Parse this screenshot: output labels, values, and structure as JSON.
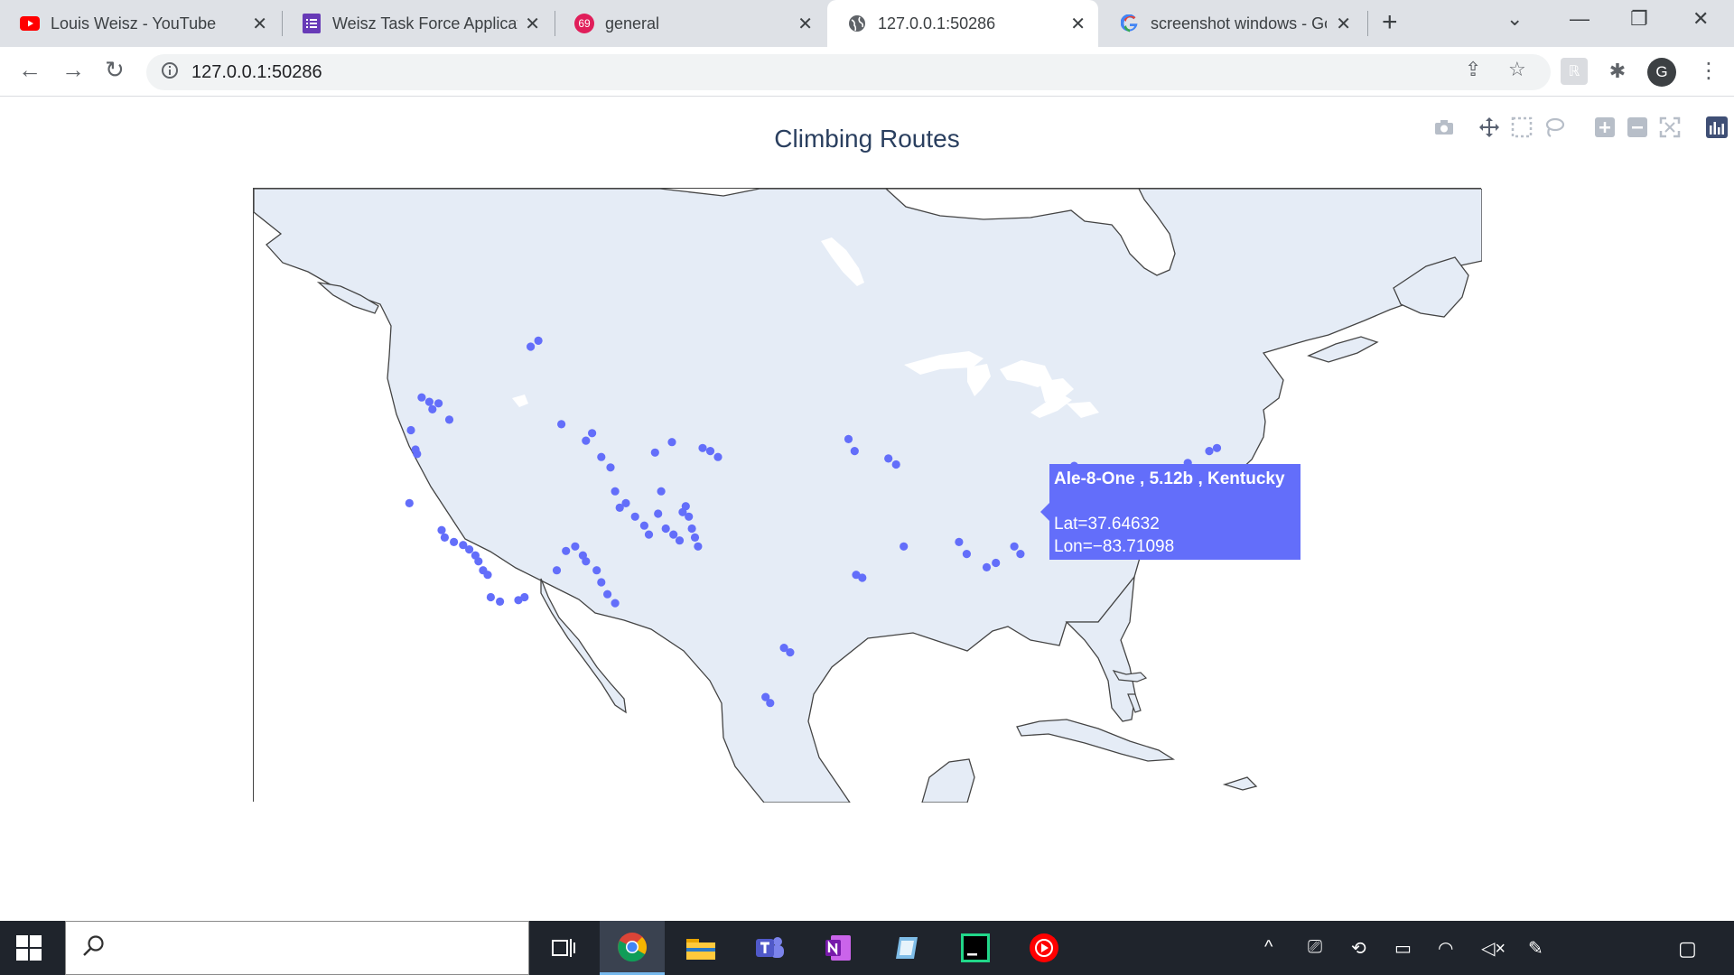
{
  "browser": {
    "tabs": [
      {
        "title": "Louis Weisz - YouTube",
        "icon": "youtube-icon"
      },
      {
        "title": "Weisz Task Force Application",
        "icon": "forms-icon"
      },
      {
        "title": "general",
        "icon": "slack-badge-icon",
        "badge": "69"
      },
      {
        "title": "127.0.0.1:50286",
        "icon": "globe-icon"
      },
      {
        "title": "screenshot windows - Google Search",
        "icon": "google-icon"
      }
    ],
    "active_tab": 3,
    "url": "127.0.0.1:50286",
    "profile_initial": "G"
  },
  "plot": {
    "title": "Climbing Routes",
    "marker_color": "#636efa",
    "land_color": "#e5ecf6",
    "modebar": [
      "camera-icon",
      "pan-icon",
      "box-select-icon",
      "lasso-icon",
      "zoom-in-icon",
      "zoom-out-icon",
      "reset-icon",
      "plotly-logo-icon"
    ],
    "tooltip": {
      "title": "Ale-8-One , 5.12b ,  Kentucky",
      "lat": "Lat=37.64632",
      "lon": "Lon=−83.71098"
    }
  },
  "chart_data": {
    "type": "scatter",
    "title": "Climbing Routes",
    "projection": "north-america",
    "lon_range": [
      -135,
      -55
    ],
    "lat_range": [
      18,
      60
    ],
    "x_label": "",
    "y_label": "",
    "points": [
      [
        -122.3,
        47.6
      ],
      [
        -121.8,
        47.3
      ],
      [
        -121.2,
        47.2
      ],
      [
        -121.6,
        46.8
      ],
      [
        -120.5,
        46.1
      ],
      [
        -123.0,
        45.4
      ],
      [
        -122.7,
        44.1
      ],
      [
        -122.6,
        43.8
      ],
      [
        -123.1,
        40.5
      ],
      [
        -121.0,
        38.7
      ],
      [
        -120.8,
        38.2
      ],
      [
        -120.2,
        37.9
      ],
      [
        -119.6,
        37.7
      ],
      [
        -119.2,
        37.4
      ],
      [
        -118.8,
        37.0
      ],
      [
        -118.6,
        36.6
      ],
      [
        -118.3,
        36.0
      ],
      [
        -118.0,
        35.7
      ],
      [
        -117.8,
        34.2
      ],
      [
        -117.2,
        33.9
      ],
      [
        -116.0,
        34.0
      ],
      [
        -115.6,
        34.2
      ],
      [
        -113.5,
        36.0
      ],
      [
        -112.9,
        37.3
      ],
      [
        -112.3,
        37.6
      ],
      [
        -111.8,
        37.0
      ],
      [
        -111.6,
        36.6
      ],
      [
        -110.9,
        36.0
      ],
      [
        -110.6,
        35.2
      ],
      [
        -110.2,
        34.4
      ],
      [
        -109.7,
        33.8
      ],
      [
        -115.2,
        51.0
      ],
      [
        -114.7,
        51.4
      ],
      [
        -113.2,
        45.8
      ],
      [
        -111.6,
        44.7
      ],
      [
        -111.2,
        45.2
      ],
      [
        -110.6,
        43.6
      ],
      [
        -110.0,
        42.9
      ],
      [
        -109.7,
        41.3
      ],
      [
        -109.4,
        40.2
      ],
      [
        -109.0,
        40.5
      ],
      [
        -108.4,
        39.6
      ],
      [
        -107.8,
        39.0
      ],
      [
        -107.5,
        38.4
      ],
      [
        -106.9,
        39.8
      ],
      [
        -106.4,
        38.8
      ],
      [
        -105.9,
        38.4
      ],
      [
        -105.5,
        38.0
      ],
      [
        -105.3,
        39.9
      ],
      [
        -105.1,
        40.3
      ],
      [
        -104.9,
        39.6
      ],
      [
        -104.7,
        38.8
      ],
      [
        -104.5,
        38.2
      ],
      [
        -104.3,
        37.6
      ],
      [
        -106.7,
        41.3
      ],
      [
        -107.1,
        43.9
      ],
      [
        -106.0,
        44.6
      ],
      [
        -104.0,
        44.2
      ],
      [
        -103.5,
        44.0
      ],
      [
        -103.0,
        43.6
      ],
      [
        -98.7,
        30.8
      ],
      [
        -98.3,
        30.5
      ],
      [
        -99.9,
        27.5
      ],
      [
        -99.6,
        27.1
      ],
      [
        -94.0,
        35.7
      ],
      [
        -93.6,
        35.5
      ],
      [
        -90.9,
        37.6
      ],
      [
        -87.3,
        37.9
      ],
      [
        -86.8,
        37.1
      ],
      [
        -85.5,
        36.2
      ],
      [
        -84.9,
        36.5
      ],
      [
        -83.7,
        37.6
      ],
      [
        -83.3,
        37.1
      ],
      [
        -94.5,
        44.8
      ],
      [
        -94.1,
        44.0
      ],
      [
        -91.9,
        43.5
      ],
      [
        -91.4,
        43.1
      ],
      [
        -79.8,
        43.0
      ],
      [
        -79.2,
        42.7
      ],
      [
        -78.4,
        41.9
      ],
      [
        -77.3,
        41.4
      ],
      [
        -76.2,
        40.9
      ],
      [
        -75.4,
        41.3
      ],
      [
        -74.6,
        41.6
      ],
      [
        -74.1,
        41.8
      ],
      [
        -73.3,
        42.4
      ],
      [
        -72.4,
        43.2
      ],
      [
        -71.0,
        44.0
      ],
      [
        -70.5,
        44.2
      ]
    ]
  }
}
